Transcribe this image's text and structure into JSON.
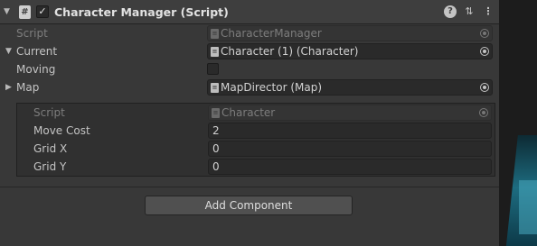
{
  "header": {
    "fold_glyph": "▼",
    "script_glyph": "#",
    "enabled_glyph": "✓",
    "title": "Character Manager (Script)",
    "help_glyph": "?",
    "preset_glyph": "⇅",
    "more_glyph": "⋮"
  },
  "fields": {
    "script": {
      "label": "Script",
      "value": "CharacterManager"
    },
    "current": {
      "fold_glyph": "▼",
      "label": "Current",
      "value": "Character (1) (Character)"
    },
    "moving": {
      "label": "Moving",
      "checked": false
    },
    "map": {
      "fold_glyph": "▶",
      "label": "Map",
      "value": "MapDirector (Map)"
    }
  },
  "nested": {
    "script": {
      "label": "Script",
      "value": "Character"
    },
    "move_cost": {
      "label": "Move Cost",
      "value": "2"
    },
    "grid_x": {
      "label": "Grid X",
      "value": "0"
    },
    "grid_y": {
      "label": "Grid Y",
      "value": "0"
    }
  },
  "object_glyph": "≡",
  "add_component_label": "Add Component",
  "colors": {
    "panel_bg": "#383838",
    "header_bg": "#3e3e3e",
    "field_bg": "#2a2a2a",
    "button_bg": "#505050",
    "text": "#c4c4c4",
    "accent_right": "#1d6c80"
  }
}
